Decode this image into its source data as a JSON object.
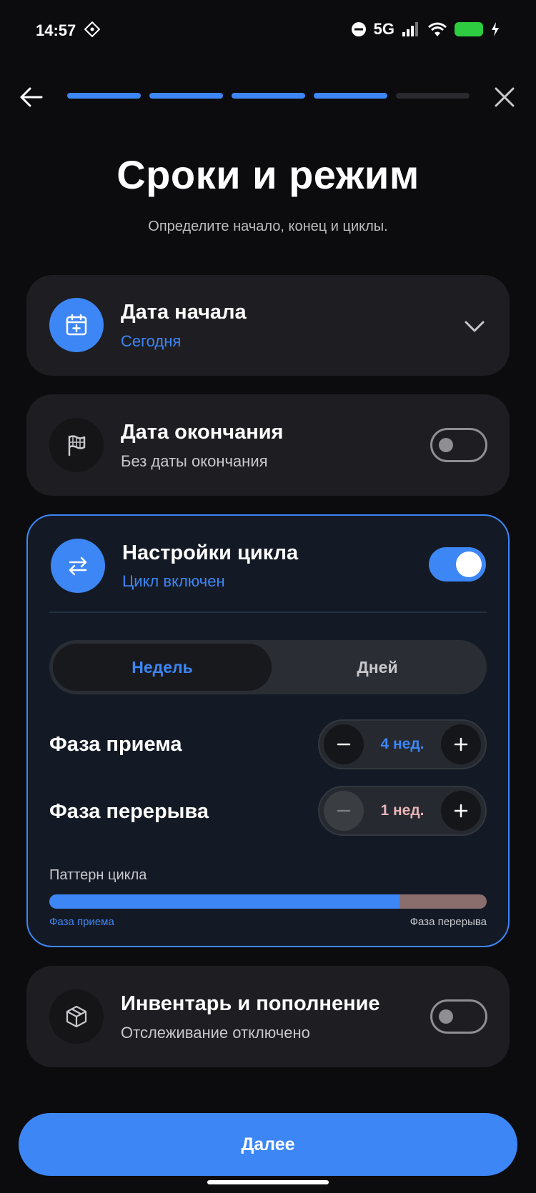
{
  "status_bar": {
    "time": "14:57",
    "network": "5G"
  },
  "header": {
    "steps_total": 5,
    "steps_done": 4
  },
  "title": "Сроки и режим",
  "subtitle": "Определите начало, конец и циклы.",
  "start_date": {
    "title": "Дата начала",
    "value": "Сегодня",
    "icon": "calendar-plus-icon"
  },
  "end_date": {
    "title": "Дата окончания",
    "value": "Без даты окончания",
    "icon": "flag-icon",
    "enabled": false
  },
  "cycle": {
    "title": "Настройки цикла",
    "status": "Цикл включен",
    "icon": "swap-arrows-icon",
    "enabled": true,
    "units": {
      "selected": "Недель",
      "options": [
        "Недель",
        "Дней"
      ]
    },
    "intake_phase": {
      "label": "Фаза приема",
      "value": "4 нед."
    },
    "break_phase": {
      "label": "Фаза перерыва",
      "value": "1 нед."
    },
    "pattern": {
      "label": "Паттерн цикла",
      "intake_label": "Фаза приема",
      "break_label": "Фаза перерыва",
      "intake_weeks": 4,
      "break_weeks": 1
    }
  },
  "inventory": {
    "title": "Инвентарь и пополнение",
    "status": "Отслеживание отключено",
    "icon": "box-icon",
    "enabled": false
  },
  "next_button": "Далее",
  "colors": {
    "accent": "#3d86f5",
    "background": "#0c0c0e",
    "card": "#1d1d22",
    "break": "#8a6e6e"
  }
}
